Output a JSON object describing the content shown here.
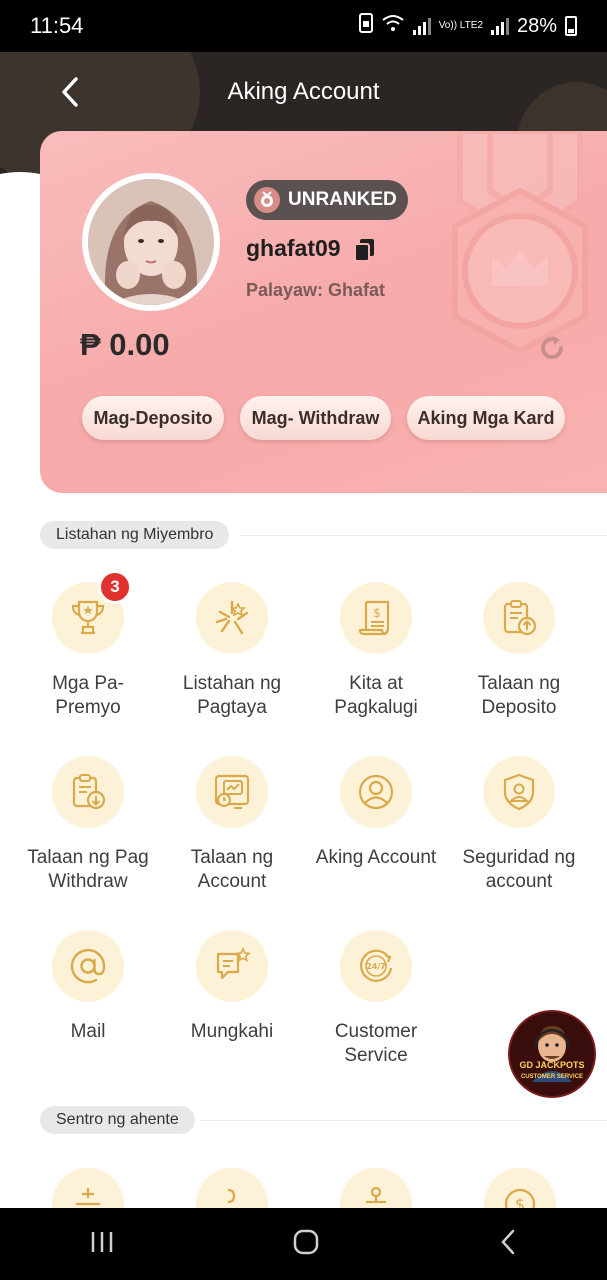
{
  "status_bar": {
    "time": "11:54",
    "network": "Vo)) LTE2",
    "battery": "28%"
  },
  "header": {
    "title": "Aking Account"
  },
  "profile": {
    "rank": "UNRANKED",
    "username": "ghafat09",
    "nickname": "Palayaw: Ghafat",
    "balance": "₱ 0.00",
    "actions": [
      "Mag-Deposito",
      "Mag- Withdraw",
      "Aking Mga Kard"
    ]
  },
  "member_section": {
    "label": "Listahan ng Miyembro",
    "items": [
      {
        "label_1": "Mga Pa-",
        "label_2": "Premyo",
        "icon": "trophy-icon",
        "badge": "3"
      },
      {
        "label_1": "Listahan ng",
        "label_2": "Pagtaya",
        "icon": "bet-star-icon"
      },
      {
        "label_1": "Kita at",
        "label_2": "Pagkalugi",
        "icon": "receipt-dollar-icon"
      },
      {
        "label_1": "Talaan ng",
        "label_2": "Deposito",
        "icon": "clipboard-upload-icon"
      },
      {
        "label_1": "Talaan ng Pag",
        "label_2": "Withdraw",
        "icon": "clipboard-download-icon"
      },
      {
        "label_1": "Talaan ng",
        "label_2": "Account",
        "icon": "account-record-icon"
      },
      {
        "label_1": "Aking Account",
        "label_2": "",
        "icon": "user-circle-icon"
      },
      {
        "label_1": "Seguridad ng",
        "label_2": "account",
        "icon": "shield-user-icon"
      },
      {
        "label_1": "Mail",
        "label_2": "",
        "icon": "at-sign-icon"
      },
      {
        "label_1": "Mungkahi",
        "label_2": "",
        "icon": "feedback-icon"
      },
      {
        "label_1": "Customer",
        "label_2": "Service",
        "icon": "support-24-7-icon"
      }
    ]
  },
  "agent_section": {
    "label": "Sentro ng ahente",
    "icons": [
      "agent-icon",
      "user-add-icon",
      "network-icon",
      "dollar-coin-icon"
    ]
  },
  "floating_support": {
    "line_1": "GD JACKPOTS",
    "line_2": "CUSTOMER SERVICE"
  },
  "colors": {
    "card_pink": "#f7a9a9",
    "icon_gold": "#d9a94a",
    "icon_bg": "#fdf1d8",
    "badge_red": "#e0312f"
  }
}
